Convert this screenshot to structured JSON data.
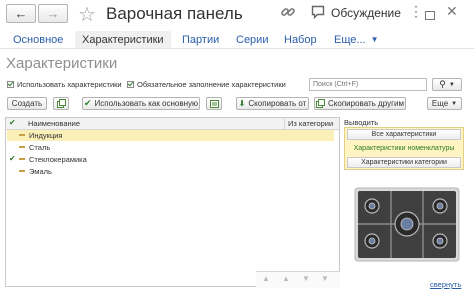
{
  "window": {
    "title": "Варочная панель",
    "discussion_label": "Обсуждение"
  },
  "tabs": [
    {
      "label": "Основное"
    },
    {
      "label": "Характеристики"
    },
    {
      "label": "Партии"
    },
    {
      "label": "Серии"
    },
    {
      "label": "Набор"
    },
    {
      "label": "Еще..."
    }
  ],
  "section": {
    "title": "Характеристики"
  },
  "options": {
    "use_characteristics": "Использовать характеристики",
    "required_fill": "Обязательное заполнение характеристики"
  },
  "search": {
    "placeholder": "Поиск (Ctrl+F)"
  },
  "toolbar": {
    "create": "Создать",
    "use_as_main": "Использовать как основную",
    "copy_from": "Скопировать от",
    "copy_to_others": "Скопировать другим",
    "more": "Еще"
  },
  "table": {
    "headers": {
      "name": "Наименование",
      "from_category": "Из категории"
    },
    "rows": [
      {
        "name": "Индукция",
        "checked": false,
        "selected": true
      },
      {
        "name": "Сталь",
        "checked": false,
        "selected": false
      },
      {
        "name": "Стеклокерамика",
        "checked": true,
        "selected": false
      },
      {
        "name": "Эмаль",
        "checked": false,
        "selected": false
      }
    ]
  },
  "side": {
    "title": "Выводить",
    "options": [
      {
        "label": "Все характеристики",
        "active": false
      },
      {
        "label": "Характеристики номенклатуры",
        "active": true
      },
      {
        "label": "Характеристики категории",
        "active": false
      }
    ],
    "collapse_link": "свернуть"
  },
  "colors": {
    "accent": "#2a5ea8",
    "selection": "#fbefb8",
    "green": "#2a7d2a",
    "active_option": "#fff4c2"
  }
}
